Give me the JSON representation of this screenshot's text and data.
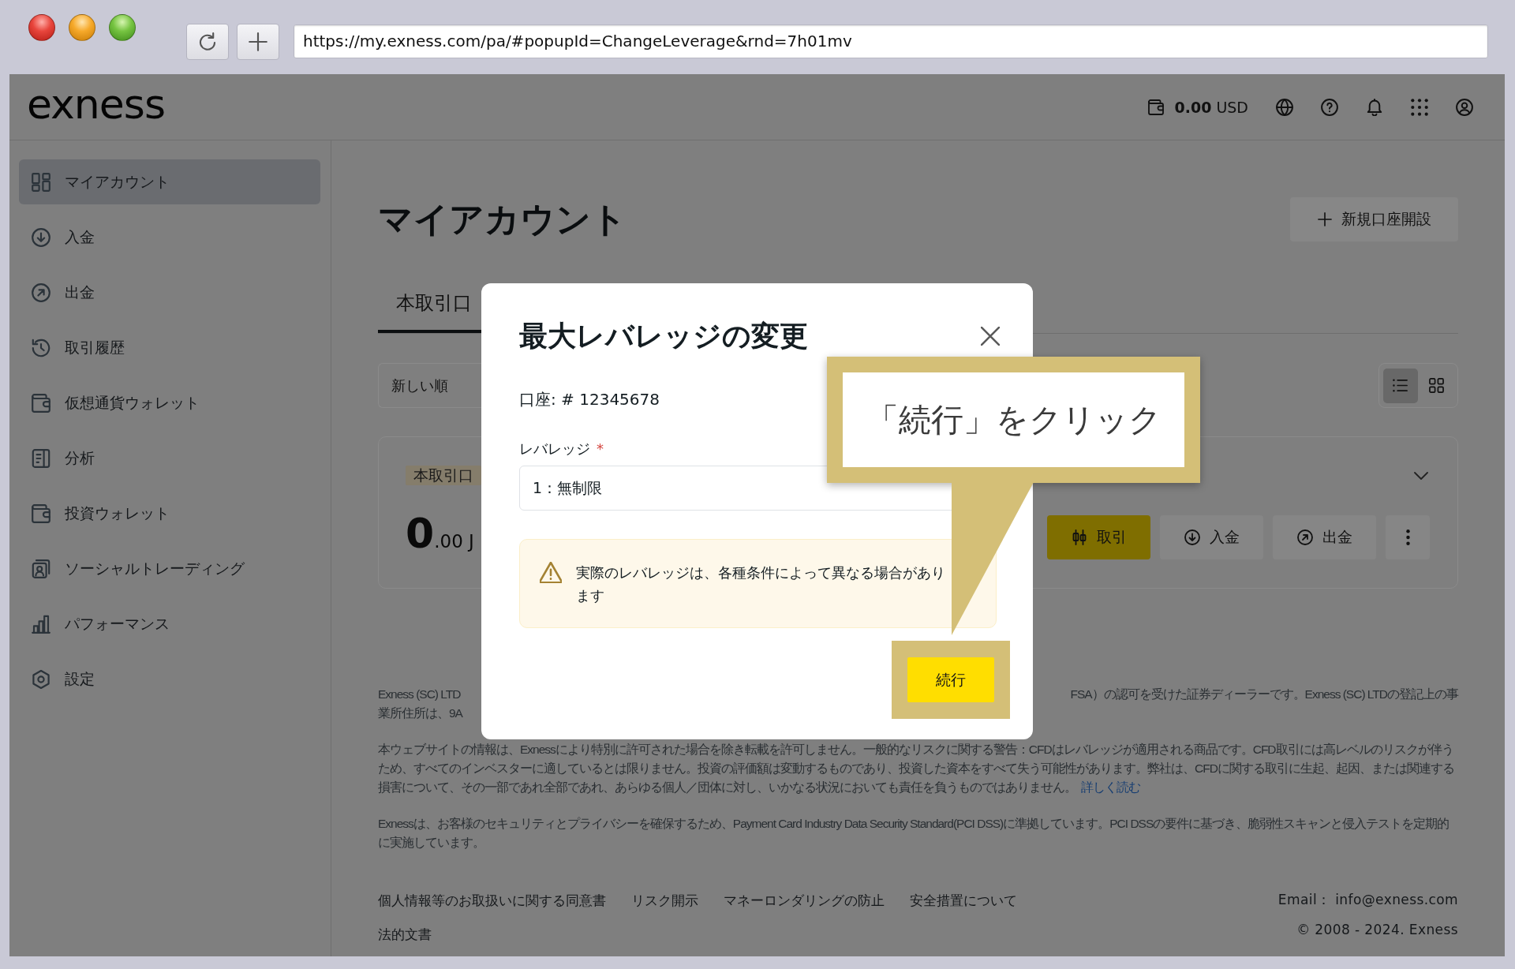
{
  "browser": {
    "url": "https://my.exness.com/pa/#popupId=ChangeLeverage&rnd=7h01mv"
  },
  "header": {
    "logo": "exness",
    "balance": {
      "amount": "0.00",
      "currency": "USD"
    }
  },
  "sidebar": {
    "items": [
      {
        "label": "マイアカウント",
        "selected": true
      },
      {
        "label": "入金",
        "selected": false
      },
      {
        "label": "出金",
        "selected": false
      },
      {
        "label": "取引履歴",
        "selected": false
      },
      {
        "label": "仮想通貨ウォレット",
        "selected": false
      },
      {
        "label": "分析",
        "selected": false
      },
      {
        "label": "投資ウォレット",
        "selected": false
      },
      {
        "label": "ソーシャルトレーディング",
        "selected": false
      },
      {
        "label": "パフォーマンス",
        "selected": false
      },
      {
        "label": "設定",
        "selected": false
      }
    ]
  },
  "page": {
    "title": "マイアカウント",
    "new_account_button": "新規口座開設",
    "tabs": [
      {
        "label": "本取引口",
        "selected": true
      }
    ],
    "sort": {
      "value": "新しい順"
    },
    "view_options": [
      {
        "selected": true
      },
      {
        "selected": false
      }
    ],
    "account_card": {
      "badge": "本取引口",
      "balance_whole": "0",
      "balance_fraction": ".00 J",
      "actions": [
        {
          "label": "取引",
          "kind": "primary"
        },
        {
          "label": "入金",
          "kind": "secondary"
        },
        {
          "label": "出金",
          "kind": "secondary"
        }
      ]
    }
  },
  "footer": {
    "notice": {
      "left_lines": [
        "Exness (SC) LTD",
        "業所住所は、9A"
      ],
      "right_line": "FSA）の認可を受けた証券ディーラーです。Exness (SC) LTDの登記上の事"
    },
    "risk_warning": {
      "text": "本ウェブサイトの情報は、Exnessにより特別に許可された場合を除き転載を許可しません。一般的なリスクに関する警告：CFDはレバレッジが適用される商品です。CFD取引には高レベルのリスクが伴うため、すべてのインベスターに適しているとは限りません。投資の評価額は変動するものであり、投資した資本をすべて失う可能性があります。弊社は、CFDに関する取引に生起、起因、または関連する損害について、その一部であれ全部であれ、あらゆる個人／団体に対し、いかなる状況においても責任を負うものではありません。",
      "link": "詳しく読む"
    },
    "security_notice": "Exnessは、お客様のセキュリティとプライバシーを確保するため、Payment Card Industry Data Security Standard(PCI DSS)に準拠しています。PCI DSSの要件に基づき、脆弱性スキャンと侵入テストを定期的に実施しています。",
    "links": [
      "個人情報等のお取扱いに関する同意書",
      "リスク開示",
      "マネーロンダリングの防止",
      "安全措置について",
      "法的文書"
    ],
    "email": "Email： info@exness.com",
    "copyright": "© 2008 - 2024. Exness"
  },
  "modal": {
    "title": "最大レバレッジの変更",
    "account": "口座: # 12345678",
    "leverage": {
      "label": "レバレッジ",
      "required_mark": "*",
      "value": "1：無制限"
    },
    "warning": "実際のレバレッジは、各種条件によって異なる場合があります",
    "continue_button": "続行"
  },
  "annotation": {
    "text": "「続行」をクリック"
  }
}
